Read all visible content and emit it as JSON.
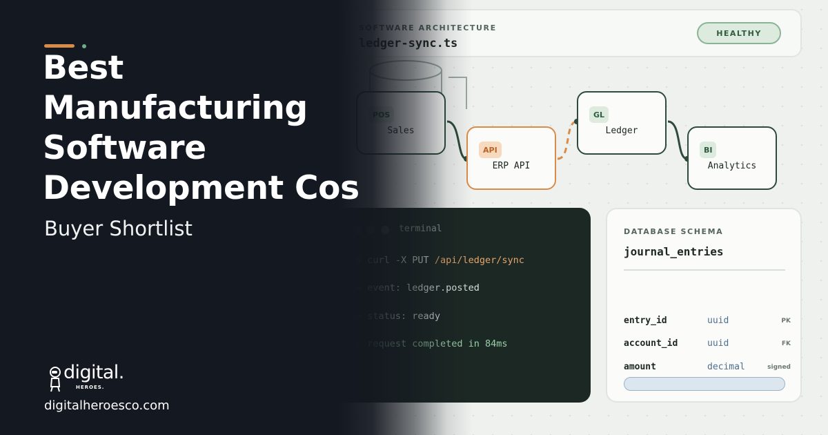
{
  "headline": {
    "lines": [
      "Best",
      "Manufacturing",
      "Software",
      "Development Cos"
    ],
    "subtitle": "Buyer Shortlist"
  },
  "brand": {
    "logo_text": "digital.",
    "logo_subtext": "HEROES.",
    "url": "digitalheroesco.com",
    "accent_color": "#d98c4a",
    "dot_color": "#6fae88"
  },
  "architecture": {
    "kicker": "SOFTWARE ARCHITECTURE",
    "file_name": "ledger-sync.ts",
    "status": "HEALTHY"
  },
  "nodes": [
    {
      "tag": "POS",
      "label": "Sales"
    },
    {
      "tag": "API",
      "label": "ERP API"
    },
    {
      "tag": "GL",
      "label": "Ledger"
    },
    {
      "tag": "BI",
      "label": "Analytics"
    }
  ],
  "terminal": {
    "title": "terminal",
    "lines": [
      {
        "prefix": "$",
        "text": "curl -X PUT",
        "highlight": "/api/ledger/sync"
      },
      {
        "prefix": "→",
        "text": "event: ledger.posted"
      },
      {
        "prefix": "→",
        "text": "status: ready"
      },
      {
        "prefix": "✓",
        "text": "request completed in 84ms"
      }
    ]
  },
  "schema": {
    "kicker": "DATABASE SCHEMA",
    "table_name": "journal_entries",
    "columns": [
      {
        "name": "entry_id",
        "type": "uuid",
        "key": "PK"
      },
      {
        "name": "account_id",
        "type": "uuid",
        "key": "FK"
      },
      {
        "name": "amount",
        "type": "decimal",
        "key": "signed"
      }
    ]
  }
}
